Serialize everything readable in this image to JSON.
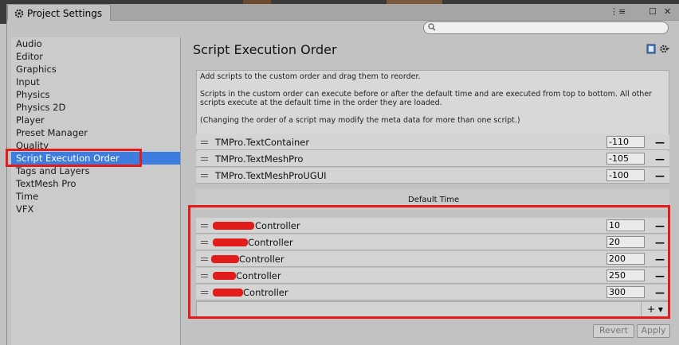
{
  "window": {
    "tab_title": "Project Settings",
    "menu_glyph": "⋮≡",
    "maximize_glyph": "☐",
    "close_glyph": "✕"
  },
  "search": {
    "placeholder": ""
  },
  "sidebar": {
    "items": [
      {
        "label": "Audio"
      },
      {
        "label": "Editor"
      },
      {
        "label": "Graphics"
      },
      {
        "label": "Input"
      },
      {
        "label": "Physics"
      },
      {
        "label": "Physics 2D"
      },
      {
        "label": "Player"
      },
      {
        "label": "Preset Manager"
      },
      {
        "label": "Quality"
      },
      {
        "label": "Script Execution Order"
      },
      {
        "label": "Tags and Layers"
      },
      {
        "label": "TextMesh Pro"
      },
      {
        "label": "Time"
      },
      {
        "label": "VFX"
      }
    ],
    "selected_index": 9
  },
  "page": {
    "title": "Script Execution Order",
    "info_line1": "Add scripts to the custom order and drag them to reorder.",
    "info_line2": "Scripts in the custom order can execute before or after the default time and are executed from top to bottom. All other scripts execute at the default time in the order they are loaded.",
    "info_line3": "(Changing the order of a script may modify the meta data for more than one script.)",
    "default_time_label": "Default Time",
    "minus_glyph": "—",
    "add_glyph": "+ ▾",
    "before_default": [
      {
        "name": "TMPro.TextContainer",
        "order": "-110"
      },
      {
        "name": "TMPro.TextMeshPro",
        "order": "-105"
      },
      {
        "name": "TMPro.TextMeshProUGUI",
        "order": "-100"
      }
    ],
    "after_default": [
      {
        "name": "Controller",
        "order": "10"
      },
      {
        "name": "Controller",
        "order": "20"
      },
      {
        "name": "Controller",
        "order": "200"
      },
      {
        "name": "Controller",
        "order": "250"
      },
      {
        "name": "Controller",
        "order": "300"
      }
    ],
    "revert_label": "Revert",
    "apply_label": "Apply"
  },
  "colors": {
    "selection": "#3e7de0",
    "annotation": "#e21b1b",
    "panel_bg": "#c2c2c2"
  }
}
